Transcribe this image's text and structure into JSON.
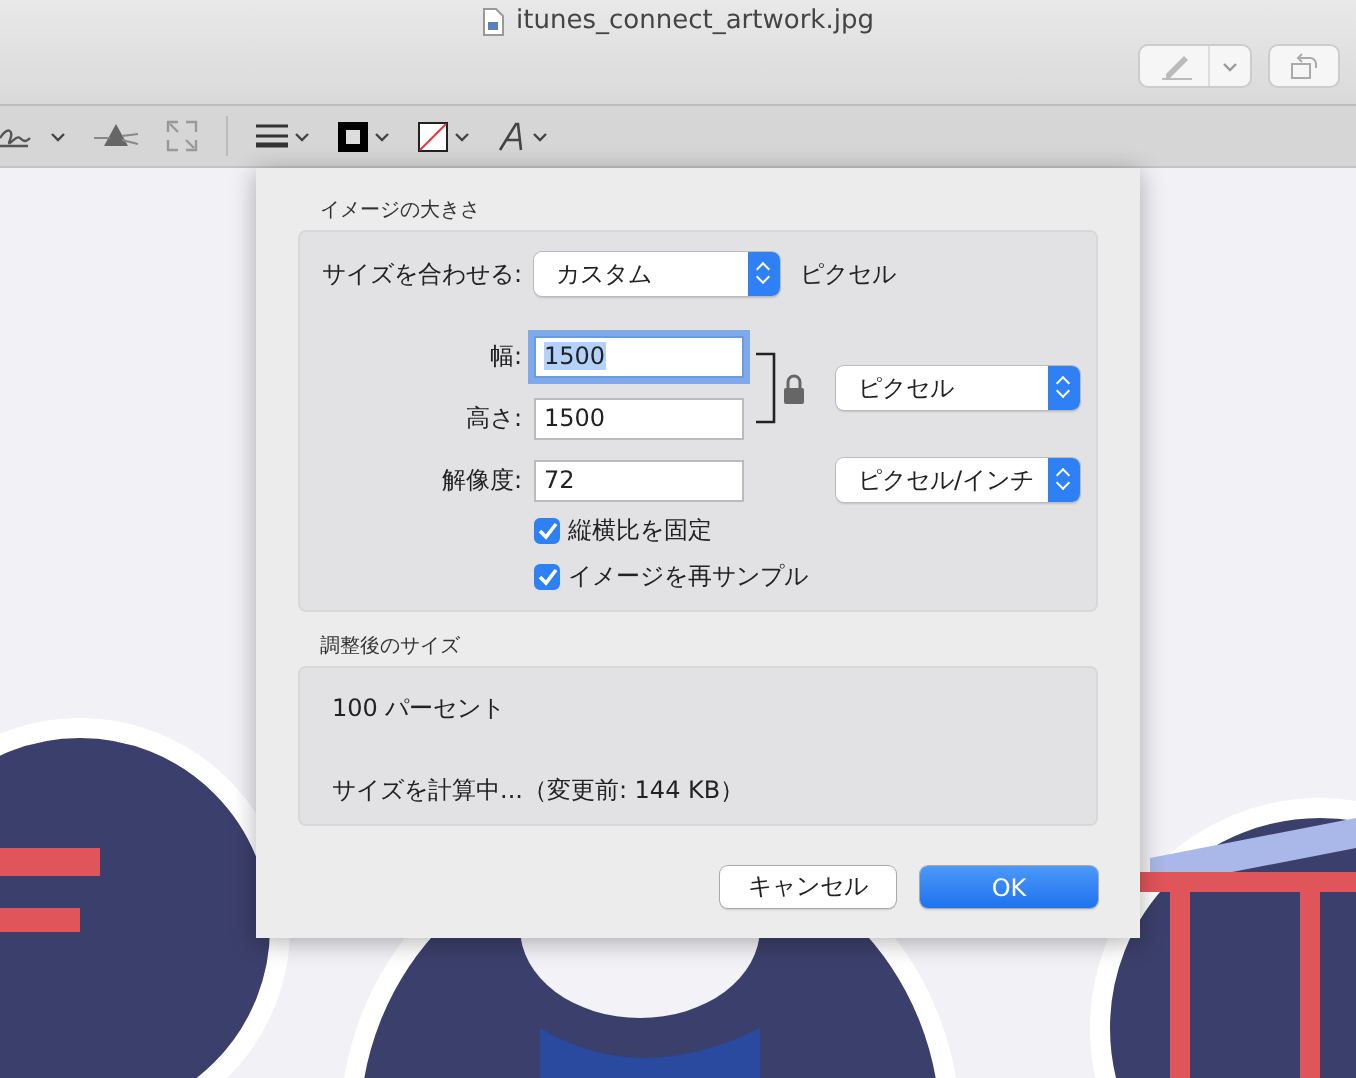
{
  "window": {
    "title": "itunes_connect_artwork.jpg"
  },
  "dialog": {
    "image_size": {
      "heading": "イメージの大きさ",
      "fit": {
        "label": "サイズを合わせる:",
        "value": "カスタム",
        "unit": "ピクセル"
      },
      "width": {
        "label": "幅:",
        "value": "1500",
        "focused": true
      },
      "height": {
        "label": "高さ:",
        "value": "1500",
        "focused": false
      },
      "size_unit": "ピクセル",
      "resolution": {
        "label": "解像度:",
        "value": "72",
        "focused": false
      },
      "resolution_unit": "ピクセル/インチ",
      "checkboxes": [
        {
          "label": "縦横比を固定",
          "checked": true
        },
        {
          "label": "イメージを再サンプル",
          "checked": true
        }
      ]
    },
    "result": {
      "heading": "調整後のサイズ",
      "percent": "100 パーセント",
      "size_note": "サイズを計算中...（変更前: 144 KB）"
    },
    "buttons": [
      {
        "label": "キャンセル",
        "kind": "secondary"
      },
      {
        "label": "OK",
        "kind": "default"
      }
    ]
  }
}
